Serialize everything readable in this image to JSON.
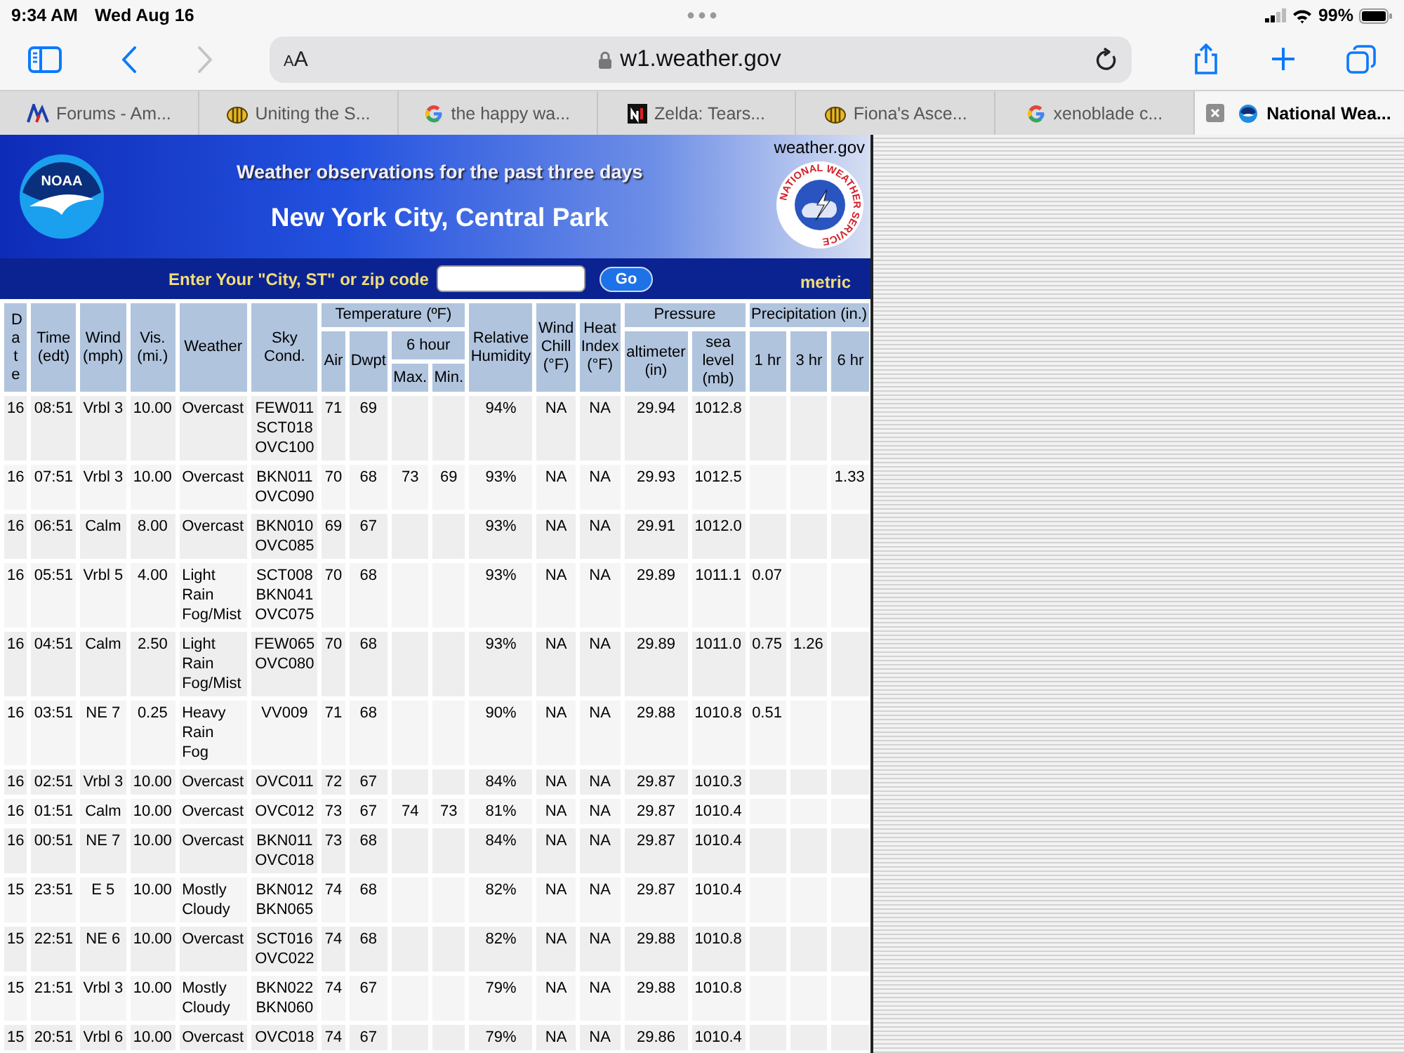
{
  "status_bar": {
    "time": "9:34 AM",
    "date": "Wed Aug 16",
    "battery": "99%"
  },
  "toolbar": {
    "nav": [
      {
        "kind": "back",
        "disabled": false
      },
      {
        "kind": "forward",
        "disabled": true
      }
    ],
    "text_size": "AA",
    "url": "w1.weather.gov"
  },
  "tabs": [
    {
      "title": "Forums - Am...",
      "kind": "aw",
      "selected": false
    },
    {
      "title": "Uniting the S...",
      "kind": "bee",
      "selected": false
    },
    {
      "title": "the happy wa...",
      "kind": "google",
      "selected": false
    },
    {
      "title": "Zelda: Tears...",
      "kind": "ni",
      "selected": false
    },
    {
      "title": "Fiona's Asce...",
      "kind": "bee",
      "selected": false
    },
    {
      "title": "xenoblade c...",
      "kind": "google",
      "selected": false
    },
    {
      "title": "National Wea...",
      "kind": "noaa",
      "selected": true
    }
  ],
  "banner": {
    "site": "weather.gov",
    "noaa_logo": "NOAA",
    "nws_logo": "NATIONAL WEATHER SERVICE",
    "heading": "Weather observations for the past three days",
    "location": "New York City, Central Park",
    "search_label": "Enter Your \"City, ST\" or zip code",
    "go_button": "Go",
    "metric_link": "metric"
  },
  "table": {
    "header_rows": [
      [
        {
          "label": "Date",
          "rowspan": 3,
          "vertical": true
        },
        {
          "label": "Time\n(edt)",
          "rowspan": 3
        },
        {
          "label": "Wind\n(mph)",
          "rowspan": 3
        },
        {
          "label": "Vis.\n(mi.)",
          "rowspan": 3
        },
        {
          "label": "Weather",
          "rowspan": 3
        },
        {
          "label": "Sky\nCond.",
          "rowspan": 3
        },
        {
          "label": "Temperature (ºF)",
          "colspan": 4
        },
        {
          "label": "Relative\nHumidity",
          "rowspan": 3
        },
        {
          "label": "Wind\nChill\n(°F)",
          "rowspan": 3
        },
        {
          "label": "Heat\nIndex\n(°F)",
          "rowspan": 3
        },
        {
          "label": "Pressure",
          "colspan": 2
        },
        {
          "label": "Precipitation (in.)",
          "colspan": 3
        }
      ],
      [
        {
          "label": "Air",
          "rowspan": 2
        },
        {
          "label": "Dwpt",
          "rowspan": 2
        },
        {
          "label": "6 hour",
          "colspan": 2
        },
        {
          "label": "altimeter\n(in)",
          "rowspan": 2
        },
        {
          "label": "sea\nlevel\n(mb)",
          "rowspan": 2
        },
        {
          "label": "1 hr",
          "rowspan": 2
        },
        {
          "label": "3 hr",
          "rowspan": 2
        },
        {
          "label": "6 hr",
          "rowspan": 2
        }
      ],
      [
        {
          "label": "Max."
        },
        {
          "label": "Min."
        }
      ]
    ],
    "rows": [
      [
        "16",
        "08:51",
        "Vrbl 3",
        "10.00",
        "Overcast",
        "FEW011\nSCT018\nOVC100",
        "71",
        "69",
        null,
        null,
        "94%",
        "NA",
        "NA",
        "29.94",
        "1012.8",
        null,
        null,
        null
      ],
      [
        "16",
        "07:51",
        "Vrbl 3",
        "10.00",
        "Overcast",
        "BKN011\nOVC090",
        "70",
        "68",
        "73",
        "69",
        "93%",
        "NA",
        "NA",
        "29.93",
        "1012.5",
        null,
        null,
        "1.33"
      ],
      [
        "16",
        "06:51",
        "Calm",
        "8.00",
        "Overcast",
        "BKN010\nOVC085",
        "69",
        "67",
        null,
        null,
        "93%",
        "NA",
        "NA",
        "29.91",
        "1012.0",
        null,
        null,
        null
      ],
      [
        "16",
        "05:51",
        "Vrbl 5",
        "4.00",
        "Light\nRain\nFog/Mist",
        "SCT008\nBKN041\nOVC075",
        "70",
        "68",
        null,
        null,
        "93%",
        "NA",
        "NA",
        "29.89",
        "1011.1",
        "0.07",
        null,
        null
      ],
      [
        "16",
        "04:51",
        "Calm",
        "2.50",
        "Light\nRain\nFog/Mist",
        "FEW065\nOVC080",
        "70",
        "68",
        null,
        null,
        "93%",
        "NA",
        "NA",
        "29.89",
        "1011.0",
        "0.75",
        "1.26",
        null
      ],
      [
        "16",
        "03:51",
        "NE 7",
        "0.25",
        "Heavy\nRain\nFog",
        "VV009",
        "71",
        "68",
        null,
        null,
        "90%",
        "NA",
        "NA",
        "29.88",
        "1010.8",
        "0.51",
        null,
        null
      ],
      [
        "16",
        "02:51",
        "Vrbl 3",
        "10.00",
        "Overcast",
        "OVC011",
        "72",
        "67",
        null,
        null,
        "84%",
        "NA",
        "NA",
        "29.87",
        "1010.3",
        null,
        null,
        null
      ],
      [
        "16",
        "01:51",
        "Calm",
        "10.00",
        "Overcast",
        "OVC012",
        "73",
        "67",
        "74",
        "73",
        "81%",
        "NA",
        "NA",
        "29.87",
        "1010.4",
        null,
        null,
        null
      ],
      [
        "16",
        "00:51",
        "NE 7",
        "10.00",
        "Overcast",
        "BKN011\nOVC018",
        "73",
        "68",
        null,
        null,
        "84%",
        "NA",
        "NA",
        "29.87",
        "1010.4",
        null,
        null,
        null
      ],
      [
        "15",
        "23:51",
        "E 5",
        "10.00",
        "Mostly\nCloudy",
        "BKN012\nBKN065",
        "74",
        "68",
        null,
        null,
        "82%",
        "NA",
        "NA",
        "29.87",
        "1010.4",
        null,
        null,
        null
      ],
      [
        "15",
        "22:51",
        "NE 6",
        "10.00",
        "Overcast",
        "SCT016\nOVC022",
        "74",
        "68",
        null,
        null,
        "82%",
        "NA",
        "NA",
        "29.88",
        "1010.8",
        null,
        null,
        null
      ],
      [
        "15",
        "21:51",
        "Vrbl 3",
        "10.00",
        "Mostly\nCloudy",
        "BKN022\nBKN060",
        "74",
        "67",
        null,
        null,
        "79%",
        "NA",
        "NA",
        "29.88",
        "1010.8",
        null,
        null,
        null
      ],
      [
        "15",
        "20:51",
        "Vrbl 6",
        "10.00",
        "Overcast",
        "OVC018",
        "74",
        "67",
        null,
        null,
        "79%",
        "NA",
        "NA",
        "29.86",
        "1010.4",
        null,
        null,
        null
      ]
    ]
  }
}
